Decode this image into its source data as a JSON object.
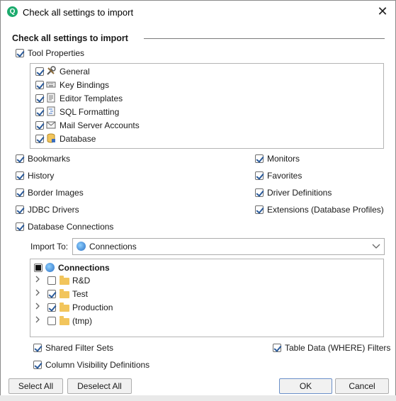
{
  "window": {
    "title": "Check all settings to import",
    "app_icon": "Q",
    "close_glyph": "✕"
  },
  "section_title": "Check all settings to import",
  "tool_properties": {
    "label": "Tool Properties",
    "checked": true,
    "items": [
      {
        "label": "General",
        "icon": "tools-icon",
        "checked": true
      },
      {
        "label": "Key Bindings",
        "icon": "keyboard-icon",
        "checked": true
      },
      {
        "label": "Editor Templates",
        "icon": "template-icon",
        "checked": true
      },
      {
        "label": "SQL Formatting",
        "icon": "sql-format-icon",
        "checked": true
      },
      {
        "label": "Mail Server Accounts",
        "icon": "mail-icon",
        "checked": true
      },
      {
        "label": "Database",
        "icon": "database-icon",
        "checked": true
      }
    ]
  },
  "left_options": [
    {
      "label": "Bookmarks",
      "checked": true
    },
    {
      "label": "History",
      "checked": true
    },
    {
      "label": "Border Images",
      "checked": true
    },
    {
      "label": "JDBC Drivers",
      "checked": true
    },
    {
      "label": "Database Connections",
      "checked": true
    }
  ],
  "right_options": [
    {
      "label": "Monitors",
      "checked": true
    },
    {
      "label": "Favorites",
      "checked": true
    },
    {
      "label": "Driver Definitions",
      "checked": true
    },
    {
      "label": "Extensions (Database Profiles)",
      "checked": true
    }
  ],
  "import_to": {
    "label": "Import To:",
    "value": "Connections"
  },
  "tree": {
    "root": {
      "label": "Connections",
      "state": "partial"
    },
    "children": [
      {
        "label": "R&D",
        "checked": false
      },
      {
        "label": "Test",
        "checked": true
      },
      {
        "label": "Production",
        "checked": true
      },
      {
        "label": "(tmp)",
        "checked": false
      }
    ]
  },
  "extra_options": {
    "shared_filter_sets": {
      "label": "Shared Filter Sets",
      "checked": true
    },
    "column_visibility": {
      "label": "Column Visibility Definitions",
      "checked": true
    },
    "table_data_filters": {
      "label": "Table Data (WHERE) Filters",
      "checked": true
    }
  },
  "buttons": {
    "select_all": "Select All",
    "deselect_all": "Deselect All",
    "ok": "OK",
    "cancel": "Cancel"
  }
}
